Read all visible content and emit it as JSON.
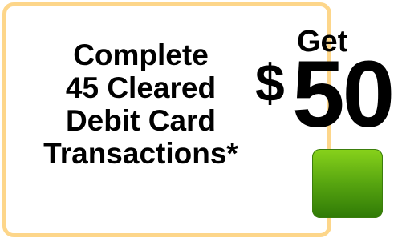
{
  "promo": {
    "line1": "Complete",
    "line2": "45 Cleared",
    "line3": "Debit Card",
    "line4": "Transactions*"
  },
  "offer": {
    "get": "Get",
    "currency": "$",
    "amount": "50"
  },
  "colors": {
    "card_border": "#fdd68a",
    "button_green": "#57a510",
    "text": "#000000"
  }
}
